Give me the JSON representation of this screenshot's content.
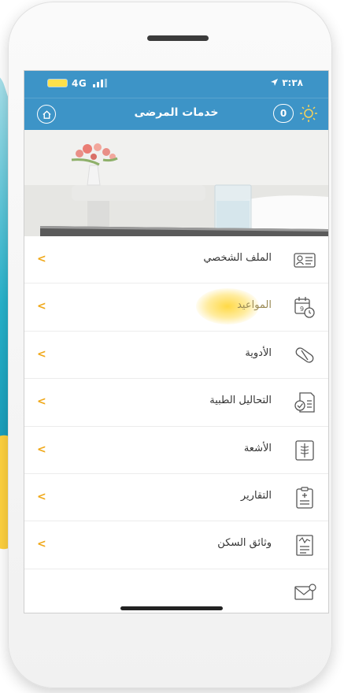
{
  "status_bar": {
    "carrier": "4G",
    "time": "٣:٣٨"
  },
  "app_bar": {
    "title": "خدمات المرضى",
    "badge_count": "0"
  },
  "menu": {
    "items": [
      {
        "label": "الملف الشخصي",
        "icon": "profile-card-icon"
      },
      {
        "label": "المواعيد",
        "icon": "calendar-clock-icon",
        "highlighted": true
      },
      {
        "label": "الأدوية",
        "icon": "pill-icon"
      },
      {
        "label": "التحاليل الطبية",
        "icon": "lab-results-icon"
      },
      {
        "label": "الأشعة",
        "icon": "xray-icon"
      },
      {
        "label": "التقارير",
        "icon": "clipboard-report-icon"
      },
      {
        "label": "وثائق السكن",
        "icon": "housing-document-icon"
      }
    ],
    "chevron": "<"
  },
  "colors": {
    "header": "#3d94c7",
    "accent": "#f0a818",
    "highlight": "#ffd23e"
  }
}
